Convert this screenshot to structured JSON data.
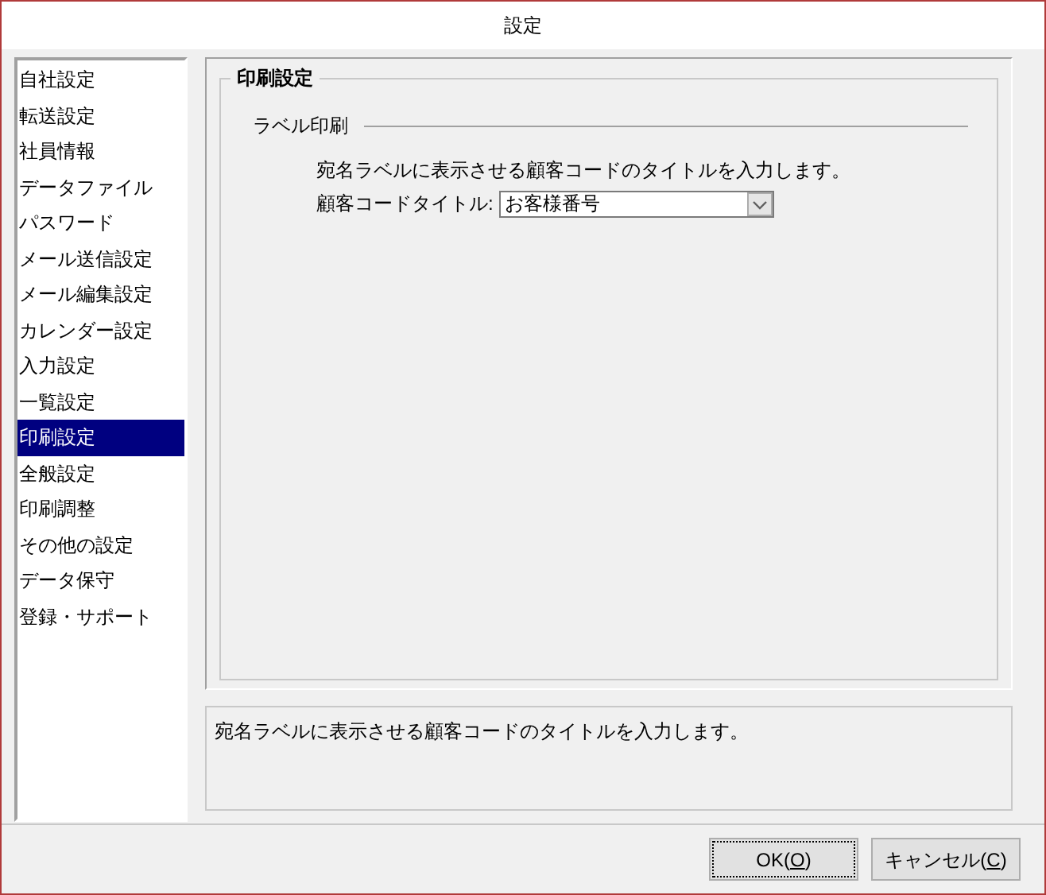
{
  "window": {
    "title": "設定"
  },
  "sidebar": {
    "items": [
      {
        "label": "自社設定",
        "selected": false
      },
      {
        "label": "転送設定",
        "selected": false
      },
      {
        "label": "社員情報",
        "selected": false
      },
      {
        "label": "データファイル",
        "selected": false
      },
      {
        "label": "パスワード",
        "selected": false
      },
      {
        "label": "メール送信設定",
        "selected": false
      },
      {
        "label": "メール編集設定",
        "selected": false
      },
      {
        "label": "カレンダー設定",
        "selected": false
      },
      {
        "label": "入力設定",
        "selected": false
      },
      {
        "label": "一覧設定",
        "selected": false
      },
      {
        "label": "印刷設定",
        "selected": true
      },
      {
        "label": "全般設定",
        "selected": false
      },
      {
        "label": "印刷調整",
        "selected": false
      },
      {
        "label": "その他の設定",
        "selected": false
      },
      {
        "label": "データ保守",
        "selected": false
      },
      {
        "label": "登録・サポート",
        "selected": false
      }
    ]
  },
  "panel": {
    "title": "印刷設定",
    "section": {
      "title": "ラベル印刷",
      "description": "宛名ラベルに表示させる顧客コードのタイトルを入力します。",
      "field": {
        "label": "顧客コードタイトル:",
        "value": "お客様番号"
      }
    }
  },
  "help_text": "宛名ラベルに表示させる顧客コードのタイトルを入力します。",
  "buttons": [
    {
      "before": "OK(",
      "mnemonic": "O",
      "after": ")",
      "focused": true
    },
    {
      "before": "キャンセル(",
      "mnemonic": "C",
      "after": ")",
      "focused": false
    }
  ]
}
